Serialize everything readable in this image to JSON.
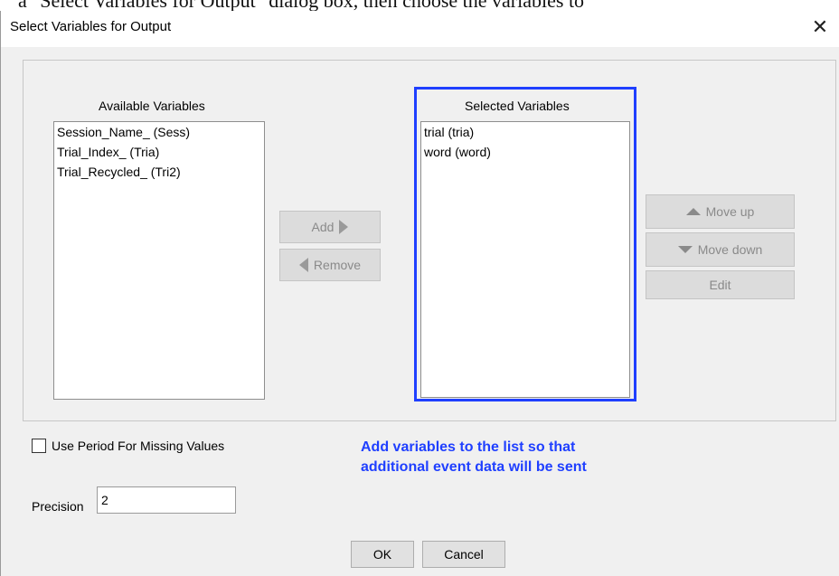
{
  "document_text": "a \"Select Variables for Output\" dialog box, then choose the variables to",
  "window": {
    "title": "Select Variables for Output",
    "close_glyph": "✕"
  },
  "available": {
    "caption": "Available Variables",
    "items": [
      "Session_Name_ (Sess)",
      "Trial_Index_ (Tria)",
      "Trial_Recycled_ (Tri2)"
    ]
  },
  "selected": {
    "caption": "Selected Variables",
    "items": [
      "trial (tria)",
      "word (word)"
    ]
  },
  "buttons": {
    "add": "Add",
    "remove": "Remove",
    "move_up": "Move up",
    "move_down": "Move down",
    "edit": "Edit",
    "ok": "OK",
    "cancel": "Cancel"
  },
  "options": {
    "use_period_label": "Use Period For Missing Values",
    "use_period_checked": false,
    "precision_label": "Precision",
    "precision_value": "2"
  },
  "annotation": {
    "line1": "Add variables to the list so that",
    "line2": "additional event data will be sent",
    "color": "#1f3fff"
  }
}
